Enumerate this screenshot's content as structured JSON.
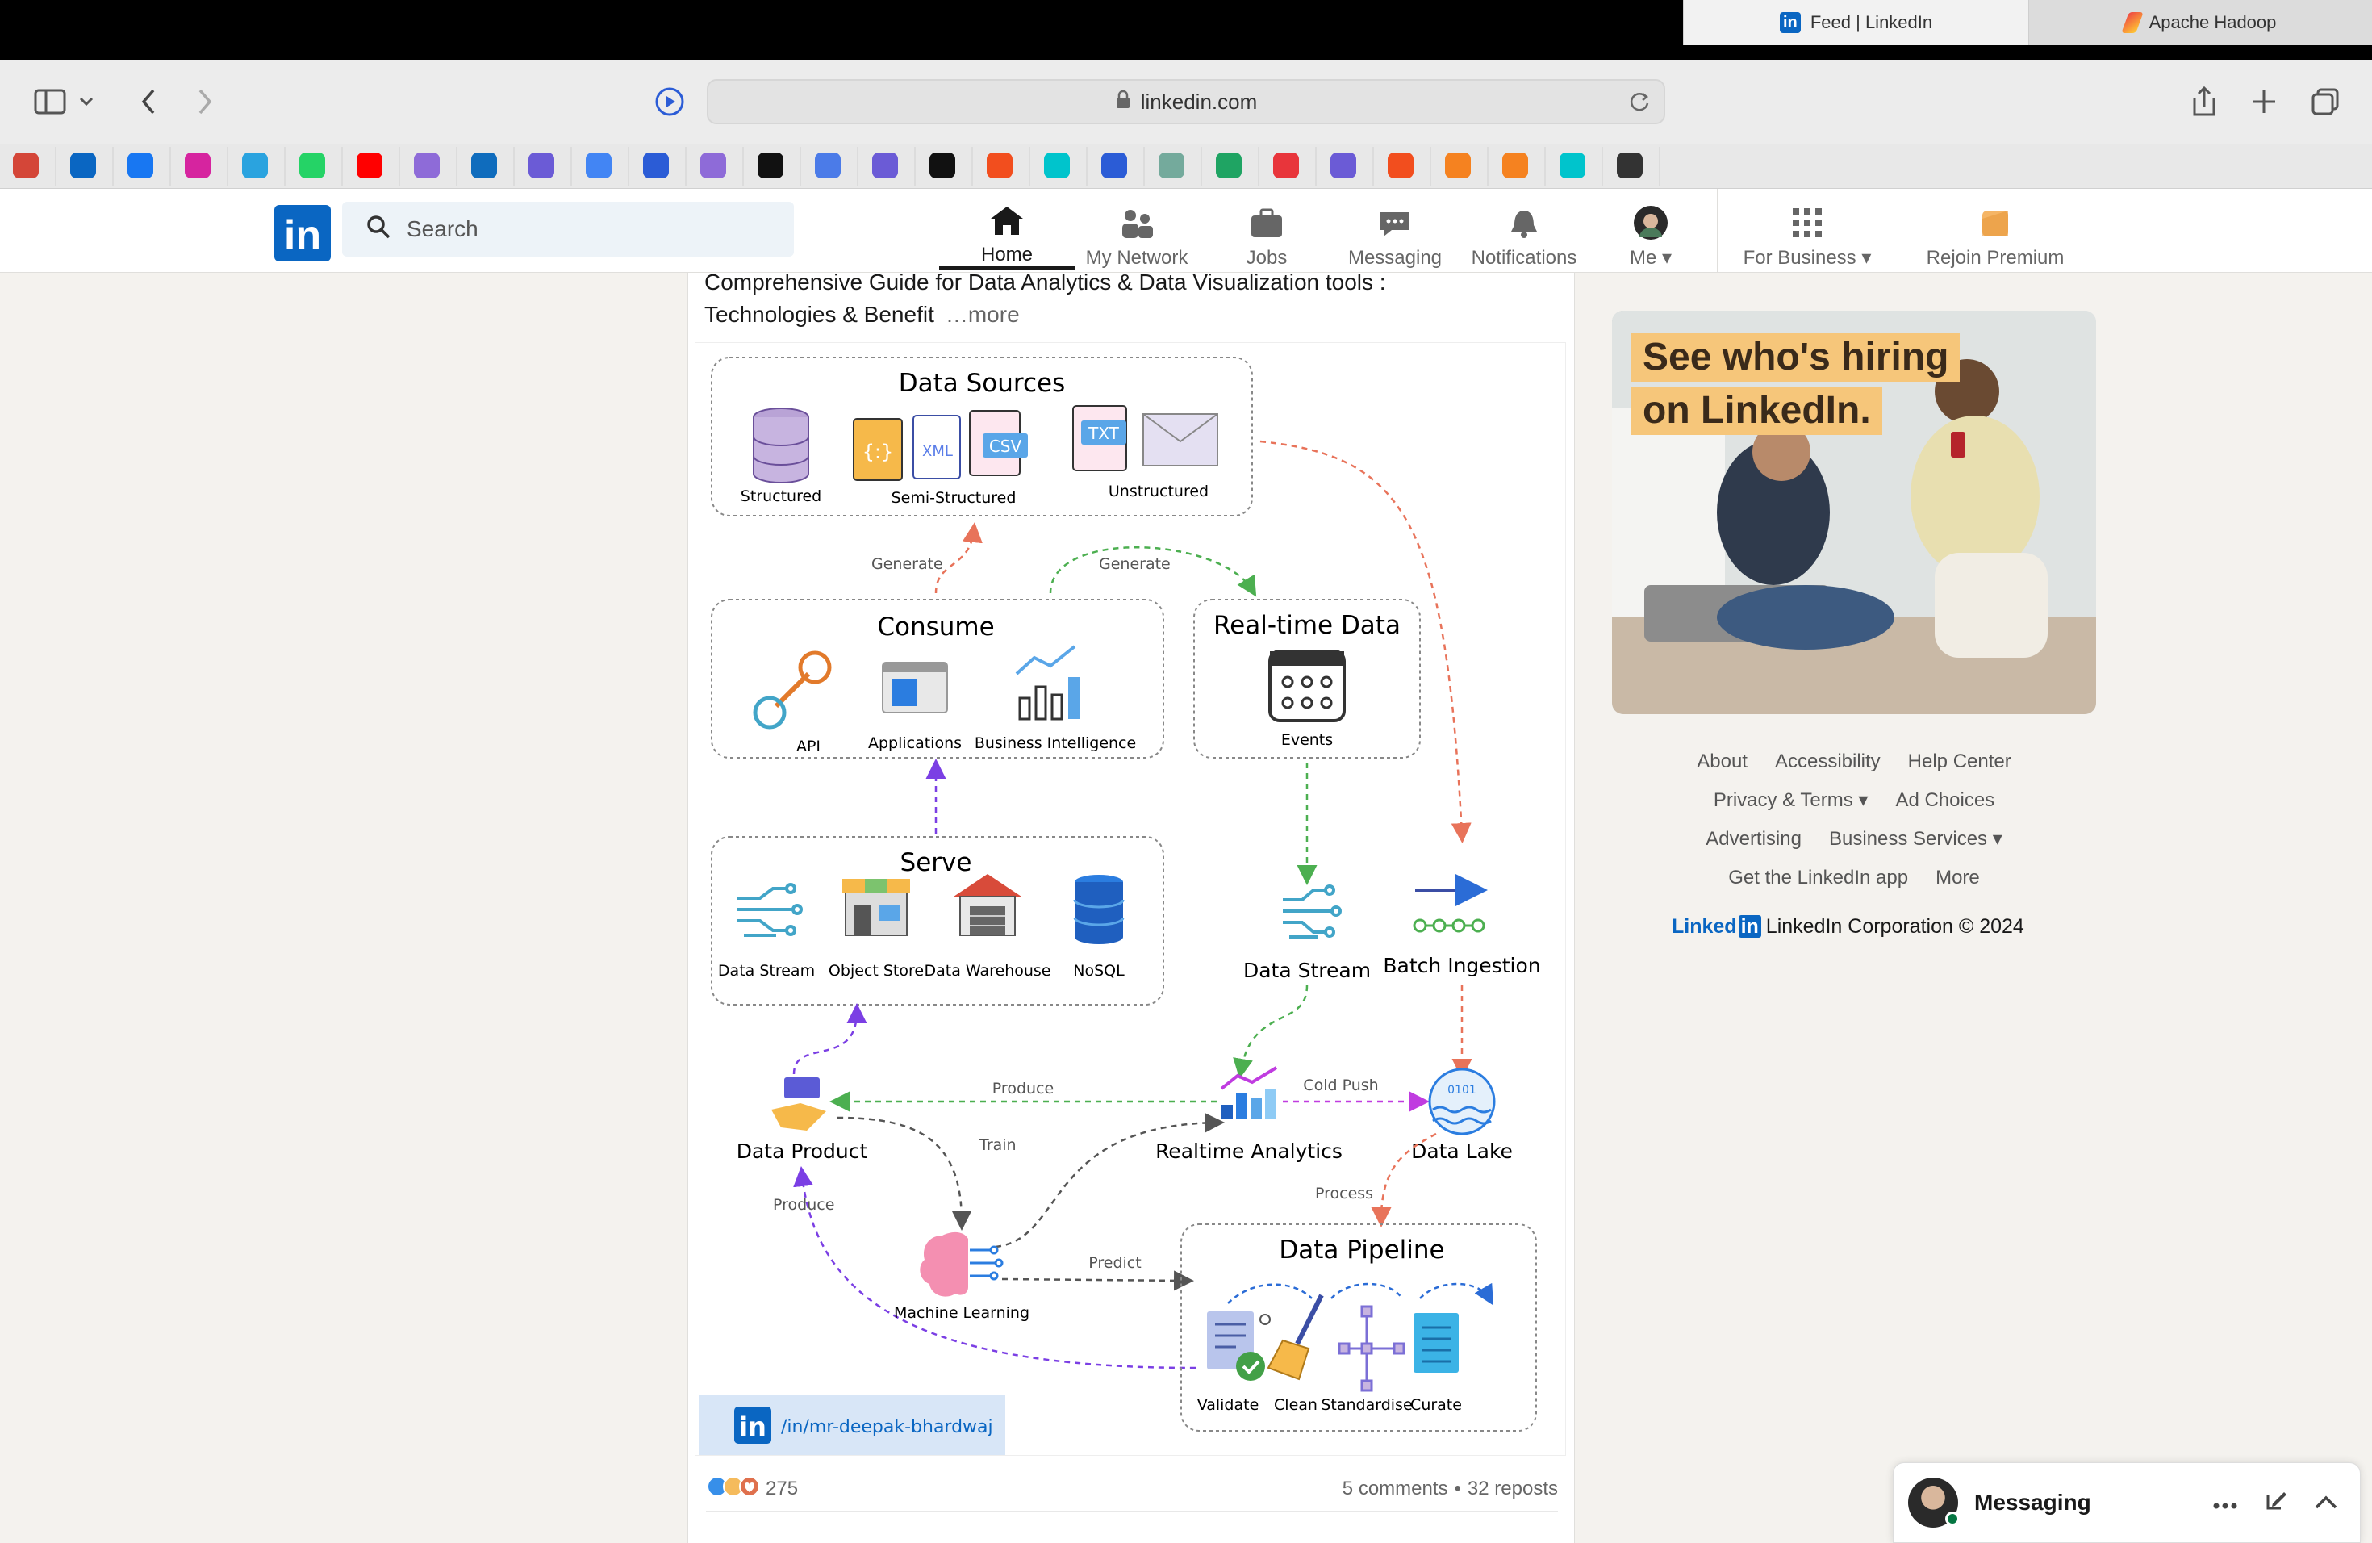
{
  "browser": {
    "url": "linkedin.com",
    "tabs": [
      {
        "title": "Feed | LinkedIn",
        "active": true
      },
      {
        "title": "Apache Hadoop",
        "active": false
      }
    ],
    "bookmark_icons": [
      "gmail-icon",
      "linkedin-icon",
      "facebook-icon",
      "instagram-icon",
      "telegram-icon",
      "whatsapp-icon",
      "youtube-icon",
      "bookmark-icon",
      "outlook-icon",
      "copilot-icon",
      "google-icon",
      "app-icon",
      "bookmark-icon",
      "openai-icon",
      "gemini-icon",
      "copilot-icon",
      "github-icon",
      "figma-icon",
      "canva-icon",
      "app-icon",
      "chatgpt-icon",
      "drive-icon",
      "app-icon",
      "copilot-icon",
      "figma-icon",
      "co-icon",
      "co-icon",
      "canva-icon",
      "app-icon"
    ]
  },
  "linkedin": {
    "search_placeholder": "Search",
    "nav": [
      {
        "label": "Home",
        "icon": "home-icon",
        "active": true
      },
      {
        "label": "My Network",
        "icon": "network-icon"
      },
      {
        "label": "Jobs",
        "icon": "briefcase-icon"
      },
      {
        "label": "Messaging",
        "icon": "messaging-icon"
      },
      {
        "label": "Notifications",
        "icon": "bell-icon"
      },
      {
        "label": "Me",
        "icon": "avatar"
      },
      {
        "label": "For Business",
        "icon": "grid-icon"
      },
      {
        "label": "Rejoin Premium",
        "icon": "premium-icon"
      }
    ]
  },
  "post": {
    "text_line1": "Comprehensive Guide for Data Analytics & Data Visualization tools :",
    "text_line2": "Technologies & Benefit",
    "more": "…more",
    "reactions_count": "275",
    "comments": "5 comments",
    "separator": "•",
    "reposts": "32 reposts"
  },
  "diagram": {
    "data_sources": {
      "title": "Data Sources",
      "structured": "Structured",
      "semi": "Semi-Structured",
      "unstructured": "Unstructured",
      "xml": "XML",
      "csv": "CSV",
      "txt": "TXT",
      "json": "{:}"
    },
    "consume": {
      "title": "Consume",
      "api": "API",
      "apps": "Applications",
      "bi": "Business Intelligence"
    },
    "realtime": {
      "title": "Real-time Data",
      "events": "Events"
    },
    "serve": {
      "title": "Serve",
      "stream": "Data Stream",
      "object": "Object Store",
      "warehouse": "Data Warehouse",
      "nosql": "NoSQL"
    },
    "data_stream": "Data Stream",
    "batch": "Batch Ingestion",
    "product": "Data Product",
    "realtime_analytics": "Realtime Analytics",
    "lake": "Data Lake",
    "ml": "Machine Learning",
    "pipeline": {
      "title": "Data Pipeline",
      "validate": "Validate",
      "clean": "Clean",
      "standardise": "Standardise",
      "curate": "Curate"
    },
    "labels": {
      "generate1": "Generate",
      "generate2": "Generate",
      "produce1": "Produce",
      "cold_push": "Cold Push",
      "train": "Train",
      "process": "Process",
      "produce2": "Produce",
      "predict": "Predict"
    },
    "profile": "/in/mr-deepak-bhardwaj",
    "binary": "0101"
  },
  "ad": {
    "line1": "See who's hiring",
    "line2": "on LinkedIn."
  },
  "footer": {
    "row1": [
      "About",
      "Accessibility",
      "Help Center"
    ],
    "row2": [
      "Privacy & Terms",
      "Ad Choices"
    ],
    "row3": [
      "Advertising",
      "Business Services"
    ],
    "row4": [
      "Get the LinkedIn app",
      "More"
    ],
    "brand": "Linked",
    "corp": "LinkedIn Corporation © 2024"
  },
  "messaging": {
    "label": "Messaging"
  },
  "colors": {
    "linkedin_blue": "#0a66c2",
    "orange_arrow": "#e8735a",
    "green_arrow": "#4caf50",
    "purple_arrow": "#7b3fe4",
    "magenta_arrow": "#c03ce0"
  }
}
